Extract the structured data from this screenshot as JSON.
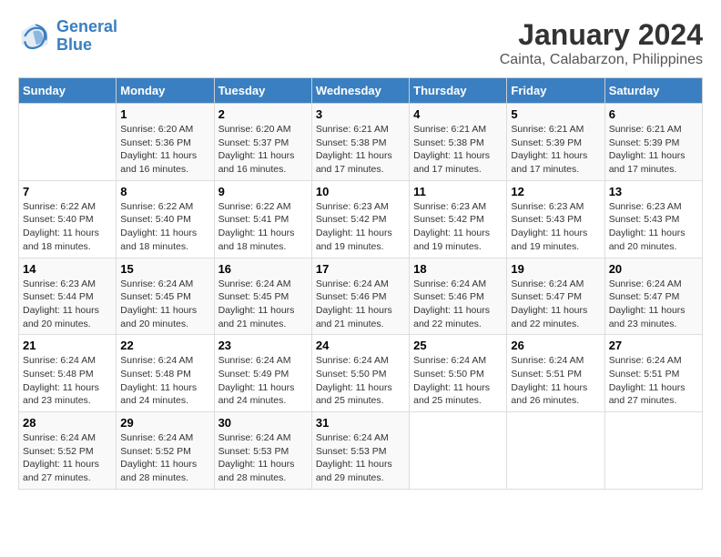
{
  "logo": {
    "line1": "General",
    "line2": "Blue"
  },
  "title": "January 2024",
  "subtitle": "Cainta, Calabarzon, Philippines",
  "days_of_week": [
    "Sunday",
    "Monday",
    "Tuesday",
    "Wednesday",
    "Thursday",
    "Friday",
    "Saturday"
  ],
  "weeks": [
    [
      {
        "day": "",
        "info": ""
      },
      {
        "day": "1",
        "info": "Sunrise: 6:20 AM\nSunset: 5:36 PM\nDaylight: 11 hours\nand 16 minutes."
      },
      {
        "day": "2",
        "info": "Sunrise: 6:20 AM\nSunset: 5:37 PM\nDaylight: 11 hours\nand 16 minutes."
      },
      {
        "day": "3",
        "info": "Sunrise: 6:21 AM\nSunset: 5:38 PM\nDaylight: 11 hours\nand 17 minutes."
      },
      {
        "day": "4",
        "info": "Sunrise: 6:21 AM\nSunset: 5:38 PM\nDaylight: 11 hours\nand 17 minutes."
      },
      {
        "day": "5",
        "info": "Sunrise: 6:21 AM\nSunset: 5:39 PM\nDaylight: 11 hours\nand 17 minutes."
      },
      {
        "day": "6",
        "info": "Sunrise: 6:21 AM\nSunset: 5:39 PM\nDaylight: 11 hours\nand 17 minutes."
      }
    ],
    [
      {
        "day": "7",
        "info": "Sunrise: 6:22 AM\nSunset: 5:40 PM\nDaylight: 11 hours\nand 18 minutes."
      },
      {
        "day": "8",
        "info": "Sunrise: 6:22 AM\nSunset: 5:40 PM\nDaylight: 11 hours\nand 18 minutes."
      },
      {
        "day": "9",
        "info": "Sunrise: 6:22 AM\nSunset: 5:41 PM\nDaylight: 11 hours\nand 18 minutes."
      },
      {
        "day": "10",
        "info": "Sunrise: 6:23 AM\nSunset: 5:42 PM\nDaylight: 11 hours\nand 19 minutes."
      },
      {
        "day": "11",
        "info": "Sunrise: 6:23 AM\nSunset: 5:42 PM\nDaylight: 11 hours\nand 19 minutes."
      },
      {
        "day": "12",
        "info": "Sunrise: 6:23 AM\nSunset: 5:43 PM\nDaylight: 11 hours\nand 19 minutes."
      },
      {
        "day": "13",
        "info": "Sunrise: 6:23 AM\nSunset: 5:43 PM\nDaylight: 11 hours\nand 20 minutes."
      }
    ],
    [
      {
        "day": "14",
        "info": "Sunrise: 6:23 AM\nSunset: 5:44 PM\nDaylight: 11 hours\nand 20 minutes."
      },
      {
        "day": "15",
        "info": "Sunrise: 6:24 AM\nSunset: 5:45 PM\nDaylight: 11 hours\nand 20 minutes."
      },
      {
        "day": "16",
        "info": "Sunrise: 6:24 AM\nSunset: 5:45 PM\nDaylight: 11 hours\nand 21 minutes."
      },
      {
        "day": "17",
        "info": "Sunrise: 6:24 AM\nSunset: 5:46 PM\nDaylight: 11 hours\nand 21 minutes."
      },
      {
        "day": "18",
        "info": "Sunrise: 6:24 AM\nSunset: 5:46 PM\nDaylight: 11 hours\nand 22 minutes."
      },
      {
        "day": "19",
        "info": "Sunrise: 6:24 AM\nSunset: 5:47 PM\nDaylight: 11 hours\nand 22 minutes."
      },
      {
        "day": "20",
        "info": "Sunrise: 6:24 AM\nSunset: 5:47 PM\nDaylight: 11 hours\nand 23 minutes."
      }
    ],
    [
      {
        "day": "21",
        "info": "Sunrise: 6:24 AM\nSunset: 5:48 PM\nDaylight: 11 hours\nand 23 minutes."
      },
      {
        "day": "22",
        "info": "Sunrise: 6:24 AM\nSunset: 5:48 PM\nDaylight: 11 hours\nand 24 minutes."
      },
      {
        "day": "23",
        "info": "Sunrise: 6:24 AM\nSunset: 5:49 PM\nDaylight: 11 hours\nand 24 minutes."
      },
      {
        "day": "24",
        "info": "Sunrise: 6:24 AM\nSunset: 5:50 PM\nDaylight: 11 hours\nand 25 minutes."
      },
      {
        "day": "25",
        "info": "Sunrise: 6:24 AM\nSunset: 5:50 PM\nDaylight: 11 hours\nand 25 minutes."
      },
      {
        "day": "26",
        "info": "Sunrise: 6:24 AM\nSunset: 5:51 PM\nDaylight: 11 hours\nand 26 minutes."
      },
      {
        "day": "27",
        "info": "Sunrise: 6:24 AM\nSunset: 5:51 PM\nDaylight: 11 hours\nand 27 minutes."
      }
    ],
    [
      {
        "day": "28",
        "info": "Sunrise: 6:24 AM\nSunset: 5:52 PM\nDaylight: 11 hours\nand 27 minutes."
      },
      {
        "day": "29",
        "info": "Sunrise: 6:24 AM\nSunset: 5:52 PM\nDaylight: 11 hours\nand 28 minutes."
      },
      {
        "day": "30",
        "info": "Sunrise: 6:24 AM\nSunset: 5:53 PM\nDaylight: 11 hours\nand 28 minutes."
      },
      {
        "day": "31",
        "info": "Sunrise: 6:24 AM\nSunset: 5:53 PM\nDaylight: 11 hours\nand 29 minutes."
      },
      {
        "day": "",
        "info": ""
      },
      {
        "day": "",
        "info": ""
      },
      {
        "day": "",
        "info": ""
      }
    ]
  ]
}
